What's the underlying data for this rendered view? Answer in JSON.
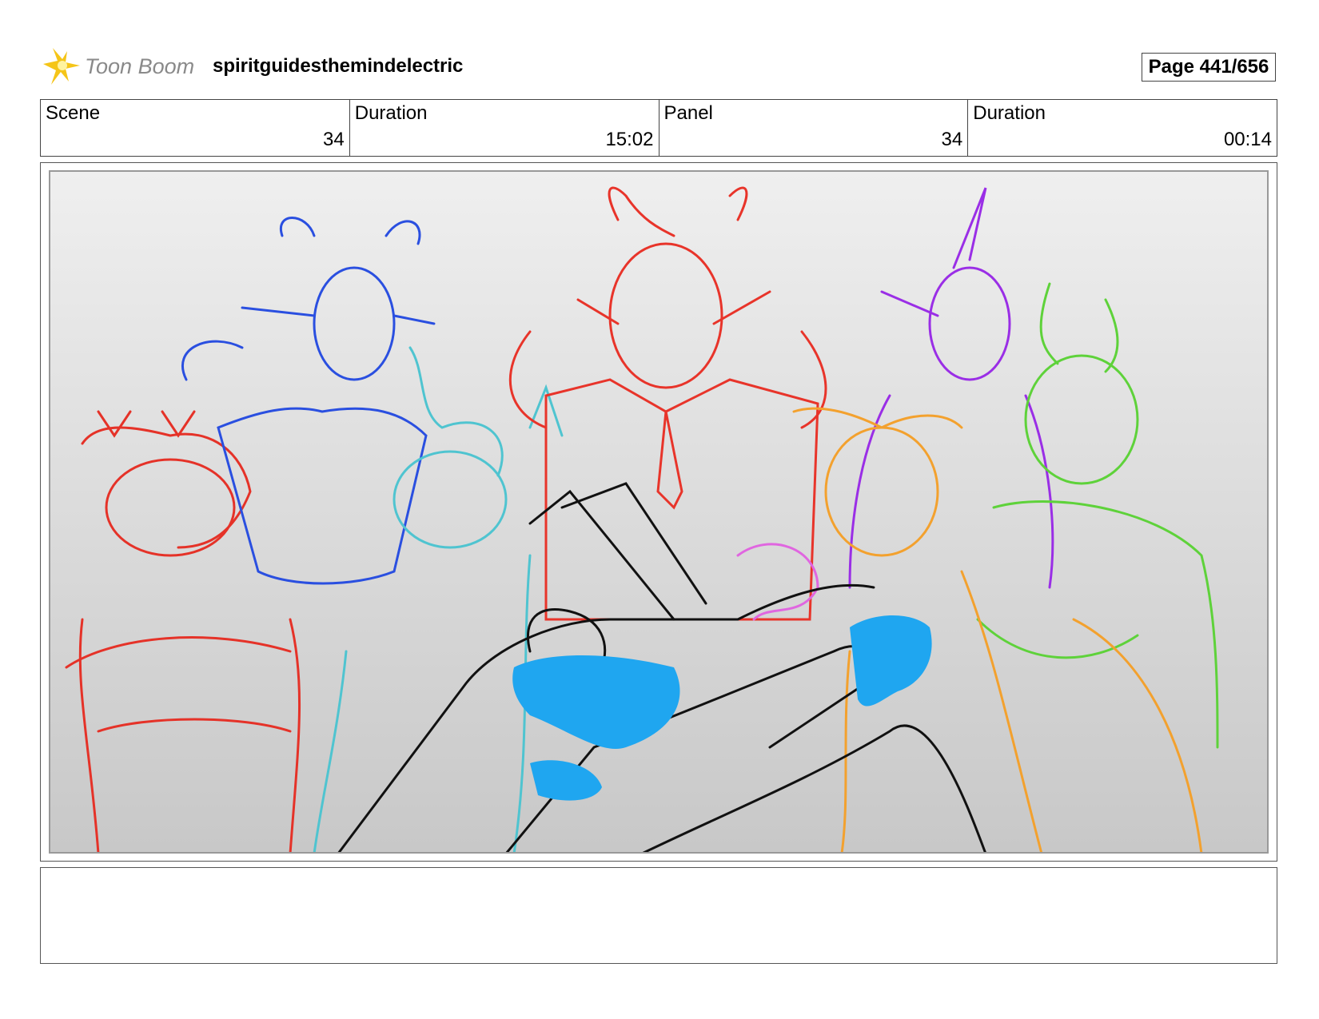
{
  "header": {
    "logo_text": "Toon Boom",
    "project_title": "spiritguidesthemindelectric",
    "page_label": "Page 441/656"
  },
  "info": {
    "scene_label": "Scene",
    "scene_value": "34",
    "scene_duration_label": "Duration",
    "scene_duration_value": "15:02",
    "panel_label": "Panel",
    "panel_value": "34",
    "panel_duration_label": "Duration",
    "panel_duration_value": "00:14"
  },
  "panel": {
    "image": "storyboard sketch of horned characters with hands in foreground",
    "colors": [
      "#e53228",
      "#2a4fe0",
      "#4fc4d0",
      "#e8342a",
      "#9a2ee6",
      "#5ed23a",
      "#f3a12e",
      "#e066e0",
      "#111111",
      "#1fa6f0"
    ]
  },
  "caption": {
    "text": ""
  }
}
